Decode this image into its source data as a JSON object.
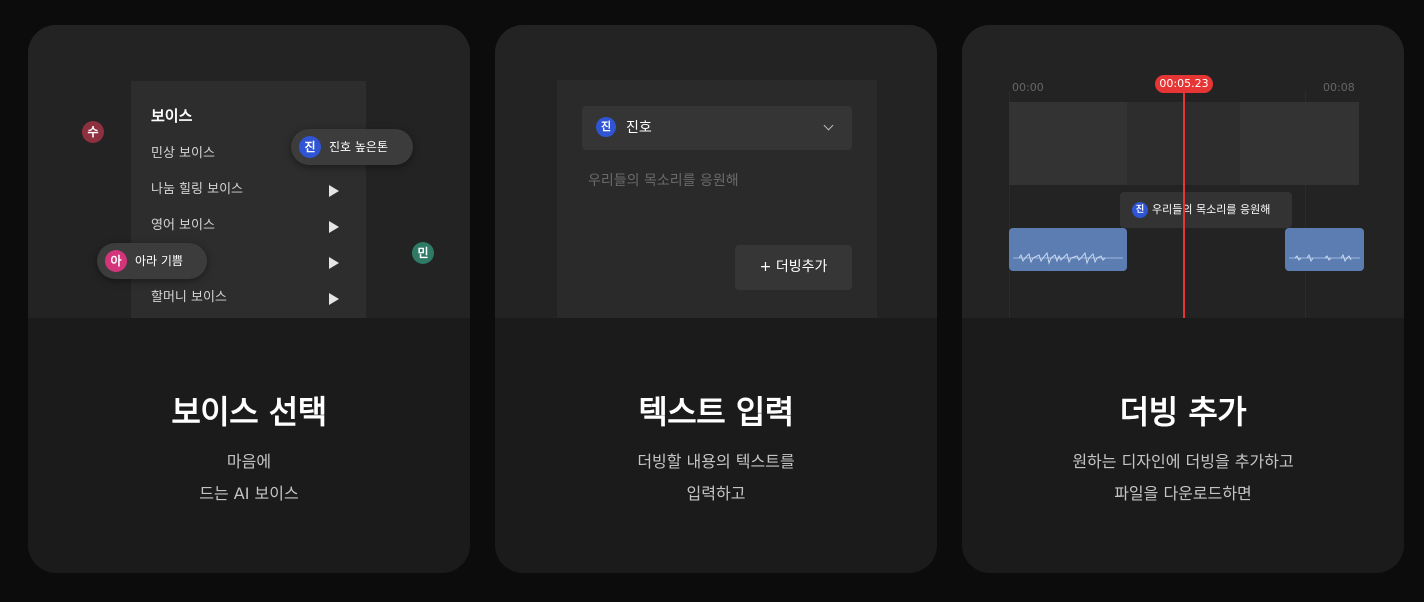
{
  "cards": [
    {
      "title": "보이스 선택",
      "desc_lines": [
        "마음에",
        "드는 AI 보이스"
      ],
      "menu": {
        "title": "보이스",
        "items": [
          {
            "label": "민상 보이스",
            "has_arrow": false
          },
          {
            "label": "나눔 힐링 보이스",
            "has_arrow": true
          },
          {
            "label": "영어 보이스",
            "has_arrow": true
          },
          {
            "label": "",
            "has_arrow": true
          },
          {
            "label": "할머니 보이스",
            "has_arrow": true
          }
        ]
      },
      "avatars": [
        {
          "char": "수",
          "color": "#8d3040"
        },
        {
          "char": "민",
          "color": "#2e7a64"
        }
      ],
      "pills": [
        {
          "char": "진",
          "label": "진호 높은톤",
          "color": "#2f55d4"
        },
        {
          "char": "아",
          "label": "아라 기쁨",
          "color": "#d2357a"
        }
      ]
    },
    {
      "title": "텍스트 입력",
      "desc_lines": [
        "더빙할 내용의 텍스트를",
        "입력하고"
      ],
      "select": {
        "char": "진",
        "label": "진호"
      },
      "placeholder": "우리들의 목소리를 응원해",
      "add_button": "+ 더빙추가"
    },
    {
      "title": "더빙 추가",
      "desc_lines": [
        "원하는 디자인에 더빙을 추가하고",
        "파일을 다운로드하면"
      ],
      "timeline": {
        "start": "00:00",
        "current": "00:05.23",
        "end": "00:08"
      },
      "subtitle": {
        "char": "진",
        "text": "우리들의 목소리를 응원해"
      }
    }
  ],
  "colors": {
    "background": "#0c0c0c",
    "card": "#1b1b1b",
    "accent_red": "#e63535",
    "avatar_blue": "#2f55d4",
    "audio_clip": "#5b7db2"
  }
}
